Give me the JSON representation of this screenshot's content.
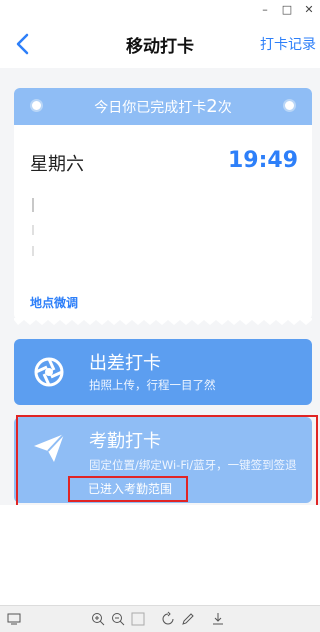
{
  "window": {
    "min": "–",
    "max": "□",
    "close": "✕"
  },
  "nav": {
    "title": "移动打卡",
    "right": "打卡记录",
    "back_icon": "chevron-left-icon"
  },
  "card": {
    "banner_prefix": "今日你已完成打卡",
    "banner_count": "2",
    "banner_suffix": "次",
    "weekday": "星期六",
    "time": "19:49",
    "adjust_link": "地点微调"
  },
  "actions": {
    "trip": {
      "title": "出差打卡",
      "subtitle": "拍照上传，行程一目了然",
      "icon": "camera-shutter-icon"
    },
    "attendance": {
      "title": "考勤打卡",
      "subtitle": "固定位置/绑定Wi-Fi/蓝牙，一键签到签退",
      "status": "已进入考勤范围",
      "icon": "paper-plane-icon"
    }
  },
  "colors": {
    "accent": "#2d7ff9",
    "banner": "#8fbdf5",
    "trip": "#5c9ef0",
    "highlight": "#e02424"
  }
}
